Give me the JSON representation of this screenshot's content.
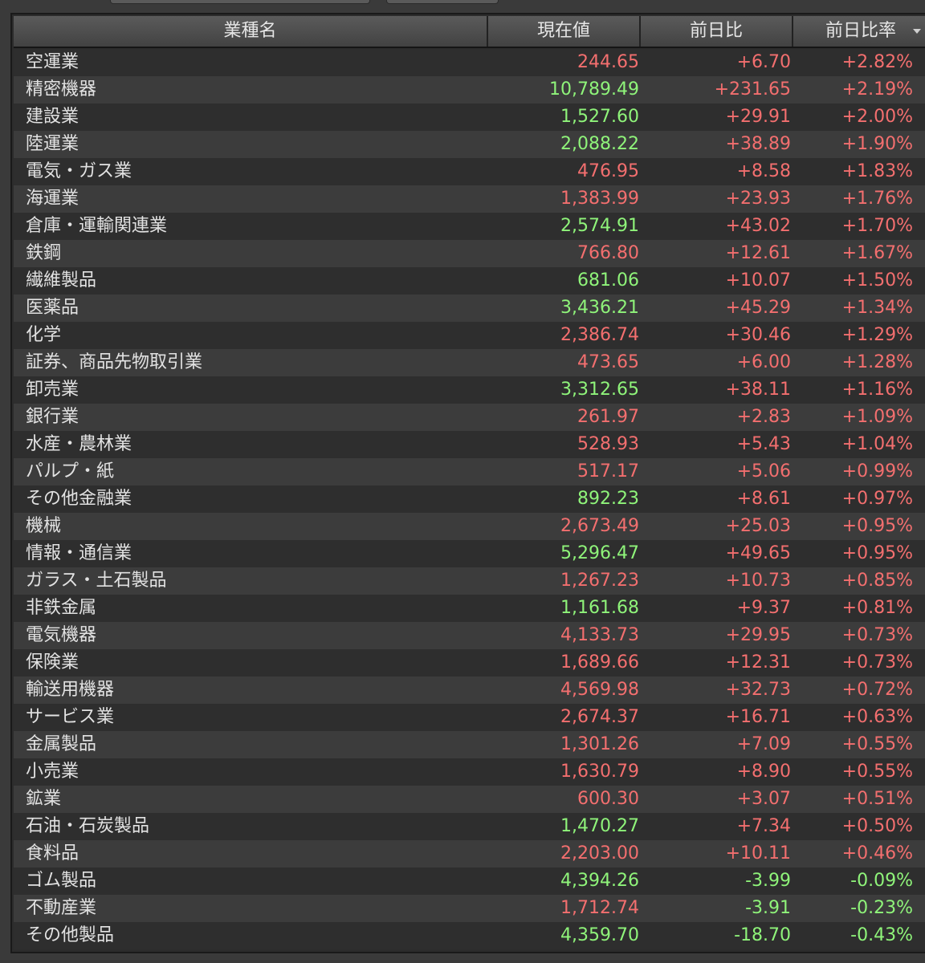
{
  "header": {
    "col_name": "業種名",
    "col_price": "現在値",
    "col_change": "前日比",
    "col_pct": "前日比率"
  },
  "colors": {
    "up": "#f36f6f",
    "down": "#8ff47a",
    "price_green": "#8ff47a",
    "price_red": "#f36f6f"
  },
  "rows": [
    {
      "name": "空運業",
      "price": "244.65",
      "price_color": "red",
      "change": "+6.70",
      "pct": "+2.82%"
    },
    {
      "name": "精密機器",
      "price": "10,789.49",
      "price_color": "green",
      "change": "+231.65",
      "pct": "+2.19%"
    },
    {
      "name": "建設業",
      "price": "1,527.60",
      "price_color": "green",
      "change": "+29.91",
      "pct": "+2.00%"
    },
    {
      "name": "陸運業",
      "price": "2,088.22",
      "price_color": "green",
      "change": "+38.89",
      "pct": "+1.90%"
    },
    {
      "name": "電気・ガス業",
      "price": "476.95",
      "price_color": "red",
      "change": "+8.58",
      "pct": "+1.83%"
    },
    {
      "name": "海運業",
      "price": "1,383.99",
      "price_color": "red",
      "change": "+23.93",
      "pct": "+1.76%"
    },
    {
      "name": "倉庫・運輸関連業",
      "price": "2,574.91",
      "price_color": "green",
      "change": "+43.02",
      "pct": "+1.70%"
    },
    {
      "name": "鉄鋼",
      "price": "766.80",
      "price_color": "red",
      "change": "+12.61",
      "pct": "+1.67%"
    },
    {
      "name": "繊維製品",
      "price": "681.06",
      "price_color": "green",
      "change": "+10.07",
      "pct": "+1.50%"
    },
    {
      "name": "医薬品",
      "price": "3,436.21",
      "price_color": "green",
      "change": "+45.29",
      "pct": "+1.34%"
    },
    {
      "name": "化学",
      "price": "2,386.74",
      "price_color": "red",
      "change": "+30.46",
      "pct": "+1.29%"
    },
    {
      "name": "証券、商品先物取引業",
      "price": "473.65",
      "price_color": "red",
      "change": "+6.00",
      "pct": "+1.28%"
    },
    {
      "name": "卸売業",
      "price": "3,312.65",
      "price_color": "green",
      "change": "+38.11",
      "pct": "+1.16%"
    },
    {
      "name": "銀行業",
      "price": "261.97",
      "price_color": "red",
      "change": "+2.83",
      "pct": "+1.09%"
    },
    {
      "name": "水産・農林業",
      "price": "528.93",
      "price_color": "red",
      "change": "+5.43",
      "pct": "+1.04%"
    },
    {
      "name": "パルプ・紙",
      "price": "517.17",
      "price_color": "red",
      "change": "+5.06",
      "pct": "+0.99%"
    },
    {
      "name": "その他金融業",
      "price": "892.23",
      "price_color": "green",
      "change": "+8.61",
      "pct": "+0.97%"
    },
    {
      "name": "機械",
      "price": "2,673.49",
      "price_color": "red",
      "change": "+25.03",
      "pct": "+0.95%"
    },
    {
      "name": "情報・通信業",
      "price": "5,296.47",
      "price_color": "green",
      "change": "+49.65",
      "pct": "+0.95%"
    },
    {
      "name": "ガラス・土石製品",
      "price": "1,267.23",
      "price_color": "red",
      "change": "+10.73",
      "pct": "+0.85%"
    },
    {
      "name": "非鉄金属",
      "price": "1,161.68",
      "price_color": "green",
      "change": "+9.37",
      "pct": "+0.81%"
    },
    {
      "name": "電気機器",
      "price": "4,133.73",
      "price_color": "red",
      "change": "+29.95",
      "pct": "+0.73%"
    },
    {
      "name": "保険業",
      "price": "1,689.66",
      "price_color": "red",
      "change": "+12.31",
      "pct": "+0.73%"
    },
    {
      "name": "輸送用機器",
      "price": "4,569.98",
      "price_color": "red",
      "change": "+32.73",
      "pct": "+0.72%"
    },
    {
      "name": "サービス業",
      "price": "2,674.37",
      "price_color": "red",
      "change": "+16.71",
      "pct": "+0.63%"
    },
    {
      "name": "金属製品",
      "price": "1,301.26",
      "price_color": "red",
      "change": "+7.09",
      "pct": "+0.55%"
    },
    {
      "name": "小売業",
      "price": "1,630.79",
      "price_color": "red",
      "change": "+8.90",
      "pct": "+0.55%"
    },
    {
      "name": "鉱業",
      "price": "600.30",
      "price_color": "red",
      "change": "+3.07",
      "pct": "+0.51%"
    },
    {
      "name": "石油・石炭製品",
      "price": "1,470.27",
      "price_color": "green",
      "change": "+7.34",
      "pct": "+0.50%"
    },
    {
      "name": "食料品",
      "price": "2,203.00",
      "price_color": "red",
      "change": "+10.11",
      "pct": "+0.46%"
    },
    {
      "name": "ゴム製品",
      "price": "4,394.26",
      "price_color": "green",
      "change": "-3.99",
      "pct": "-0.09%"
    },
    {
      "name": "不動産業",
      "price": "1,712.74",
      "price_color": "red",
      "change": "-3.91",
      "pct": "-0.23%"
    },
    {
      "name": "その他製品",
      "price": "4,359.70",
      "price_color": "green",
      "change": "-18.70",
      "pct": "-0.43%"
    }
  ]
}
